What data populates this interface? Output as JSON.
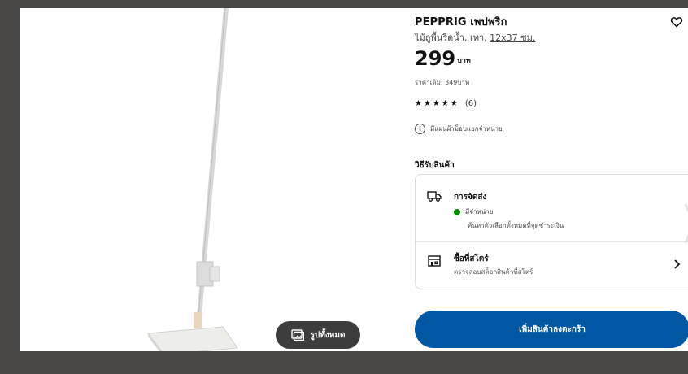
{
  "product": {
    "name": "PEPPRIG เพปพริก",
    "desc_prefix": "ไม้ถูพื้นรีดน้ำ, เทา,",
    "dimension": "12x37 ซม.",
    "price": "299",
    "currency": "บาท",
    "original_price": "ราคาเดิม: 349บาท",
    "stars": "★★★★★",
    "rating_count": "(6)",
    "notice": "มีแผ่นผ้าม็อบแยกจำหน่าย"
  },
  "gallery": {
    "all_photos_label": "รูปทั้งหมด"
  },
  "purchase": {
    "section_title": "วิธีรับสินค้า",
    "delivery": {
      "title": "การจัดส่ง",
      "availability": "มีจำหน่าย",
      "sub": "ค้นหาตัวเลือกทั้งหมดที่จุดชำระเงิน",
      "status_color": "#0a8a00"
    },
    "store": {
      "title": "ซื้อที่สโตร์",
      "sub": "ตรวจสอบสต็อกสินค้าที่สโตร์"
    },
    "cart_button": "เพิ่มสินค้าลงตะกร้า"
  },
  "colors": {
    "primary_button": "#0058a3",
    "backdrop": "#4a4846"
  },
  "icons": [
    "heart-icon",
    "info-icon",
    "truck-icon",
    "store-icon",
    "chevron-right-icon",
    "gallery-icon"
  ]
}
